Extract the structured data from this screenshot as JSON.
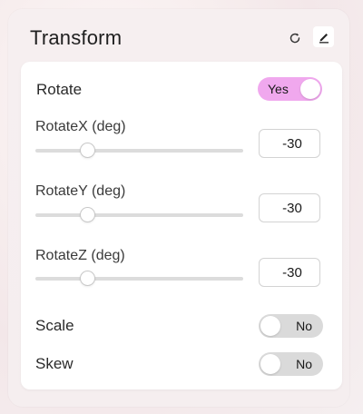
{
  "panel": {
    "title": "Transform",
    "refresh_icon": "refresh-icon",
    "edit_icon": "pencil-icon"
  },
  "rotate": {
    "label": "Rotate",
    "toggle_label": "Yes",
    "enabled": true
  },
  "fields": [
    {
      "label": "RotateX (deg)",
      "value": "-30",
      "slider_fraction": 0.25
    },
    {
      "label": "RotateY (deg)",
      "value": "-30",
      "slider_fraction": 0.25
    },
    {
      "label": "RotateZ (deg)",
      "value": "-30",
      "slider_fraction": 0.25
    }
  ],
  "scale": {
    "label": "Scale",
    "toggle_label": "No",
    "enabled": false
  },
  "skew": {
    "label": "Skew",
    "toggle_label": "No",
    "enabled": false
  },
  "colors": {
    "toggle_on": "#f0a8ee",
    "toggle_off": "#dadada"
  }
}
